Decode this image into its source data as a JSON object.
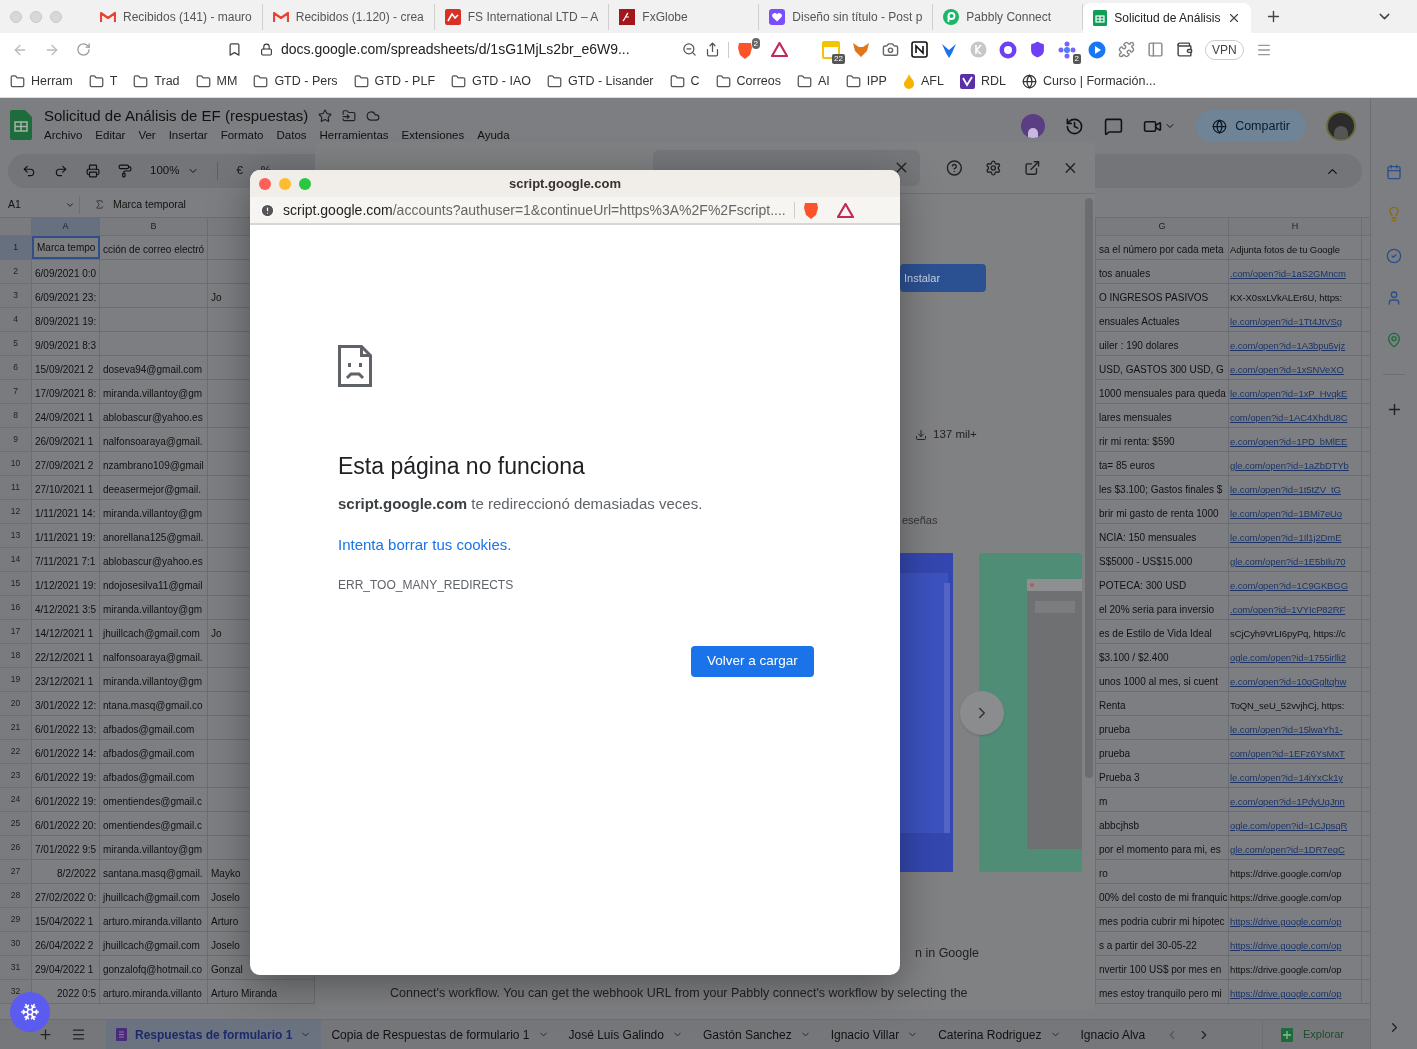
{
  "browser": {
    "tabs": [
      {
        "title": "Recibidos (141) - mauro",
        "kind": "gmail",
        "selected": false
      },
      {
        "title": "Recibidos (1.120) - crea",
        "kind": "gmail",
        "selected": false
      },
      {
        "title": "FS International LTD – A",
        "kind": "fs",
        "selected": false
      },
      {
        "title": "FxGlobe",
        "kind": "fx",
        "selected": false
      },
      {
        "title": "Diseño sin título - Post p",
        "kind": "heart",
        "selected": false
      },
      {
        "title": "Pabbly Connect",
        "kind": "pabbly",
        "selected": false
      },
      {
        "title": "Solicitud de Análisis",
        "kind": "sheets",
        "selected": true
      }
    ],
    "url": "docs.google.com/spreadsheets/d/1sG1MjLs2br_e6W9...",
    "brave_badge": "2",
    "extensions": [
      {
        "kind": "calendar",
        "badge": "22"
      },
      {
        "kind": "fox"
      },
      {
        "kind": "camera"
      },
      {
        "kind": "notion"
      },
      {
        "kind": "bird"
      },
      {
        "kind": "k"
      },
      {
        "kind": "face"
      },
      {
        "kind": "shield"
      },
      {
        "kind": "flower",
        "badge": "2"
      },
      {
        "kind": "play"
      },
      {
        "kind": "puzzle"
      },
      {
        "kind": "sidebar"
      },
      {
        "kind": "wallet"
      }
    ],
    "vpn": "VPN",
    "bookmarks": [
      {
        "label": "Herram",
        "kind": "folder"
      },
      {
        "label": "T",
        "kind": "folder"
      },
      {
        "label": "Trad",
        "kind": "folder"
      },
      {
        "label": "MM",
        "kind": "folder"
      },
      {
        "label": "GTD - Pers",
        "kind": "folder"
      },
      {
        "label": "GTD - PLF",
        "kind": "folder"
      },
      {
        "label": "GTD - IAO",
        "kind": "folder"
      },
      {
        "label": "GTD - Lisander",
        "kind": "folder"
      },
      {
        "label": "C",
        "kind": "folder"
      },
      {
        "label": "Correos",
        "kind": "folder"
      },
      {
        "label": "AI",
        "kind": "folder"
      },
      {
        "label": "IPP",
        "kind": "folder"
      },
      {
        "label": "AFL",
        "kind": "flame"
      },
      {
        "label": "RDL",
        "kind": "rdl"
      },
      {
        "label": "Curso | Formación...",
        "kind": "globe"
      }
    ]
  },
  "sheet": {
    "title": "Solicitud de Análisis de EF (respuestas)",
    "menu": [
      "Archivo",
      "Editar",
      "Ver",
      "Insertar",
      "Formato",
      "Datos",
      "Herramientas",
      "Extensiones",
      "Ayuda"
    ],
    "zoom": "100%",
    "toolbar_symbols": [
      "€",
      "%"
    ],
    "share": "Compartir",
    "name_box": "A1",
    "formula": "Marca temporal",
    "columns": {
      "a": "A",
      "b": "B",
      "g": "G",
      "h": "H"
    },
    "rows": [
      {
        "n": "1",
        "a": "Marca tempo",
        "b": "cción de correo electró",
        "g": "sa el número por cada meta",
        "h": "Adjunta fotos de tu Google",
        "link": false,
        "sel": true
      },
      {
        "n": "2",
        "a": "6/09/2021 0:0",
        "g": "tos anuales",
        "h": ".com/open?id=1aS2GMncm",
        "link": true,
        "sel": false
      },
      {
        "n": "3",
        "a": "6/09/2021 23:",
        "c": "Jo",
        "g": "O INGRESOS PASIVOS",
        "h": "KX-X0sxLVkALEr6U, https:",
        "link": false,
        "sel": false
      },
      {
        "n": "4",
        "a": "8/09/2021 19:",
        "g": "ensuales Actuales",
        "h": "le.com/open?id=1Tt4JtVSg",
        "link": true,
        "sel": false
      },
      {
        "n": "5",
        "a": "9/09/2021 8:3",
        "g": "uiler : 190 dolares",
        "h": "e.com/open?id=1A3bpu5vjz",
        "link": true,
        "sel": false
      },
      {
        "n": "6",
        "a": "15/09/2021 2",
        "b": "doseva94@gmail.com",
        "g": "USD, GASTOS 300 USD, G",
        "h": "e.com/open?id=1xSNVeXO",
        "link": true,
        "sel": false
      },
      {
        "n": "7",
        "a": "17/09/2021 8:",
        "b": "miranda.villantoy@gm",
        "g": "1000 mensuales para queda",
        "h": "le.com/open?id=1xP_HvqkE",
        "link": true,
        "sel": false
      },
      {
        "n": "8",
        "a": "24/09/2021 1",
        "b": "ablobascur@yahoo.es",
        "g": "lares mensuales",
        "h": "com/open?id=1AC4XhdU8C",
        "link": true,
        "sel": false
      },
      {
        "n": "9",
        "a": "26/09/2021 1",
        "b": "nalfonsoaraya@gmail.",
        "g": "rir mi renta: $590",
        "h": "e.com/open?id=1PD_bMlEE",
        "link": true,
        "sel": false
      },
      {
        "n": "10",
        "a": "27/09/2021 2",
        "b": "nzambrano109@gmail",
        "g": "ta= 85 euros",
        "h": "gle.com/open?id=1aZbDTYb",
        "link": true,
        "sel": false
      },
      {
        "n": "11",
        "a": "27/10/2021 1",
        "b": "deeasermejor@gmail.",
        "g": "les $3.100; Gastos finales $",
        "h": "le.com/open?id=1t5tZV_tG",
        "link": true,
        "sel": false
      },
      {
        "n": "12",
        "a": "1/11/2021 14:",
        "b": "miranda.villantoy@gm",
        "g": "brir mi gasto de renta 1000",
        "h": "le.com/open?id=1BMi7eUo",
        "link": true,
        "sel": false
      },
      {
        "n": "13",
        "a": "1/11/2021 19:",
        "b": "anorellana125@gmail.",
        "g": "NCIA: 150 mensuales",
        "h": "le.com/open?id=1Il1j2DmE",
        "link": true,
        "sel": false
      },
      {
        "n": "14",
        "a": "7/11/2021 7:1",
        "b": "ablobascur@yahoo.es",
        "g": "S$5000 - US$15.000",
        "h": "gle.com/open?id=1E5bIlu70",
        "link": true,
        "sel": false
      },
      {
        "n": "15",
        "a": "1/12/2021 19:",
        "b": "ndojosesilva11@gmail",
        "g": "POTECA:  300 USD",
        "h": "e.com/open?id=1C9GKBGG",
        "link": true,
        "sel": false
      },
      {
        "n": "16",
        "a": "4/12/2021 3:5",
        "b": "miranda.villantoy@gm",
        "g": "el 20% seria para inversio",
        "h": ".com/open?id=1VYIcP82RF",
        "link": true,
        "sel": false
      },
      {
        "n": "17",
        "a": "14/12/2021 1",
        "b": "jhuillcach@gmail.com",
        "c": "Jo",
        "g": "es de Estilo de Vida Ideal",
        "h": "sCjCyh9VrLI6pyPq, https://c",
        "link": false,
        "sel": false
      },
      {
        "n": "18",
        "a": "22/12/2021 1",
        "b": "nalfonsoaraya@gmail.",
        "g": "$3.100 / $2.400",
        "h": "ogle.com/open?id=1755irlli2",
        "link": true,
        "sel": false
      },
      {
        "n": "19",
        "a": "23/12/2021 1",
        "b": "miranda.villantoy@gm",
        "g": "unos 1000 al mes, si cuent",
        "h": "e.com/open?id=10qGgltqhw",
        "link": true,
        "sel": false
      },
      {
        "n": "20",
        "a": "3/01/2022 12:",
        "b": "ntana.masq@gmail.co",
        "g": "Renta",
        "h": "ToQN_seU_52vvjhCj, https:",
        "link": false,
        "sel": false
      },
      {
        "n": "21",
        "a": "6/01/2022 13:",
        "b": "afbados@gmail.com",
        "g": "prueba",
        "h": "le.com/open?id=15lwaYh1-",
        "link": true,
        "sel": false
      },
      {
        "n": "22",
        "a": "6/01/2022 14:",
        "b": "afbados@gmail.com",
        "g": "prueba",
        "h": "com/open?id=1EFz6YsMxT",
        "link": true,
        "sel": false
      },
      {
        "n": "23",
        "a": "6/01/2022 19:",
        "b": "afbados@gmail.com",
        "g": "Prueba 3",
        "h": "le.com/open?id=14iYxCk1y",
        "link": true,
        "sel": false
      },
      {
        "n": "24",
        "a": "6/01/2022 19:",
        "b": "omentiendes@gmail.c",
        "g": "m",
        "h": "e.com/open?id=1PdyUgJnn",
        "link": true,
        "sel": false
      },
      {
        "n": "25",
        "a": "6/01/2022 20:",
        "b": "omentiendes@gmail.c",
        "g": "abbcjhsb",
        "h": "ogle.com/open?id=1CJpsqR",
        "link": true,
        "sel": false
      },
      {
        "n": "26",
        "a": "7/01/2022 9:5",
        "b": "miranda.villantoy@gm",
        "g": "por el momento para mi, es",
        "h": "gle.com/open?id=1DR7eqC",
        "link": true,
        "sel": false
      },
      {
        "n": "27",
        "a": "8/2/2022",
        "a_right": true,
        "b": "santana.masq@gmail.",
        "c": "Mayko",
        "g": "ro",
        "h": "https://drive.google.com/op",
        "link": false,
        "sel": false
      },
      {
        "n": "28",
        "a": "27/02/2022 0:",
        "b": "jhuillcach@gmail.com",
        "c": "Joselo",
        "g": "00% del costo de mi franquic",
        "h": "https://drive.google.com/op",
        "link": false,
        "sel": false
      },
      {
        "n": "29",
        "a": "15/04/2022 1",
        "b": "arturo.miranda.villanto",
        "c": "Arturo",
        "g": "mes podria cubrir mi hipotec",
        "h": "https://drive.google.com/op",
        "link": true,
        "sel": false
      },
      {
        "n": "30",
        "a": "26/04/2022 2",
        "b": "jhuillcach@gmail.com",
        "c": "Joselo",
        "g": "s a partir del 30-05-22",
        "h": "https://drive.google.com/op",
        "link": true,
        "sel": false
      },
      {
        "n": "31",
        "a": "29/04/2022 1",
        "b": "gonzalofq@hotmail.co",
        "c": "Gonzal",
        "g": "nvertir 100 US$ por mes en",
        "h": "https://drive.google.com/op",
        "link": false,
        "sel": false
      },
      {
        "n": "32",
        "a": "2022 0:5",
        "a_right": true,
        "b": "arturo.miranda.villanto",
        "c": "Arturo Miranda",
        "g": "mes estoy tranquilo pero mi",
        "h": "https://drive.google.com/op",
        "link": true,
        "sel": false
      }
    ],
    "sheet_tabs": [
      {
        "label": "Respuestas de formulario 1",
        "kind": "form",
        "selected": true
      },
      {
        "label": "Copia de Respuestas de formulario 1",
        "kind": "sheet",
        "selected": false
      },
      {
        "label": "José Luis Galindo",
        "kind": "sheet",
        "selected": false
      },
      {
        "label": "Gastón Sanchez",
        "kind": "sheet",
        "selected": false
      },
      {
        "label": "Ignacio Villar",
        "kind": "sheet",
        "selected": false
      },
      {
        "label": "Caterina Rodriguez",
        "kind": "sheet",
        "selected": false
      },
      {
        "label": "Ignacio Alva",
        "kind": "sheet",
        "selected": false
      }
    ],
    "explore": "Explorar"
  },
  "marketplace": {
    "install": "Instalar",
    "downloads": "137 mil+",
    "reviews": "eseñas",
    "description_lines": [
      "n in Google",
      "Connect's workflow. You can get the webhook URL from your Pabbly connect's workflow by selecting the"
    ]
  },
  "popup": {
    "title": "script.google.com",
    "url_host": "script.google.com",
    "url_rest": "/accounts?authuser=1&continueUrl=https%3A%2F%2Fscript....",
    "heading": "Esta página no funciona",
    "message": "**script.google.com** te redireccionó demasiadas veces.",
    "link": "Intenta borrar tus cookies.",
    "error_code": "ERR_TOO_MANY_REDIRECTS",
    "button": "Volver a cargar"
  }
}
